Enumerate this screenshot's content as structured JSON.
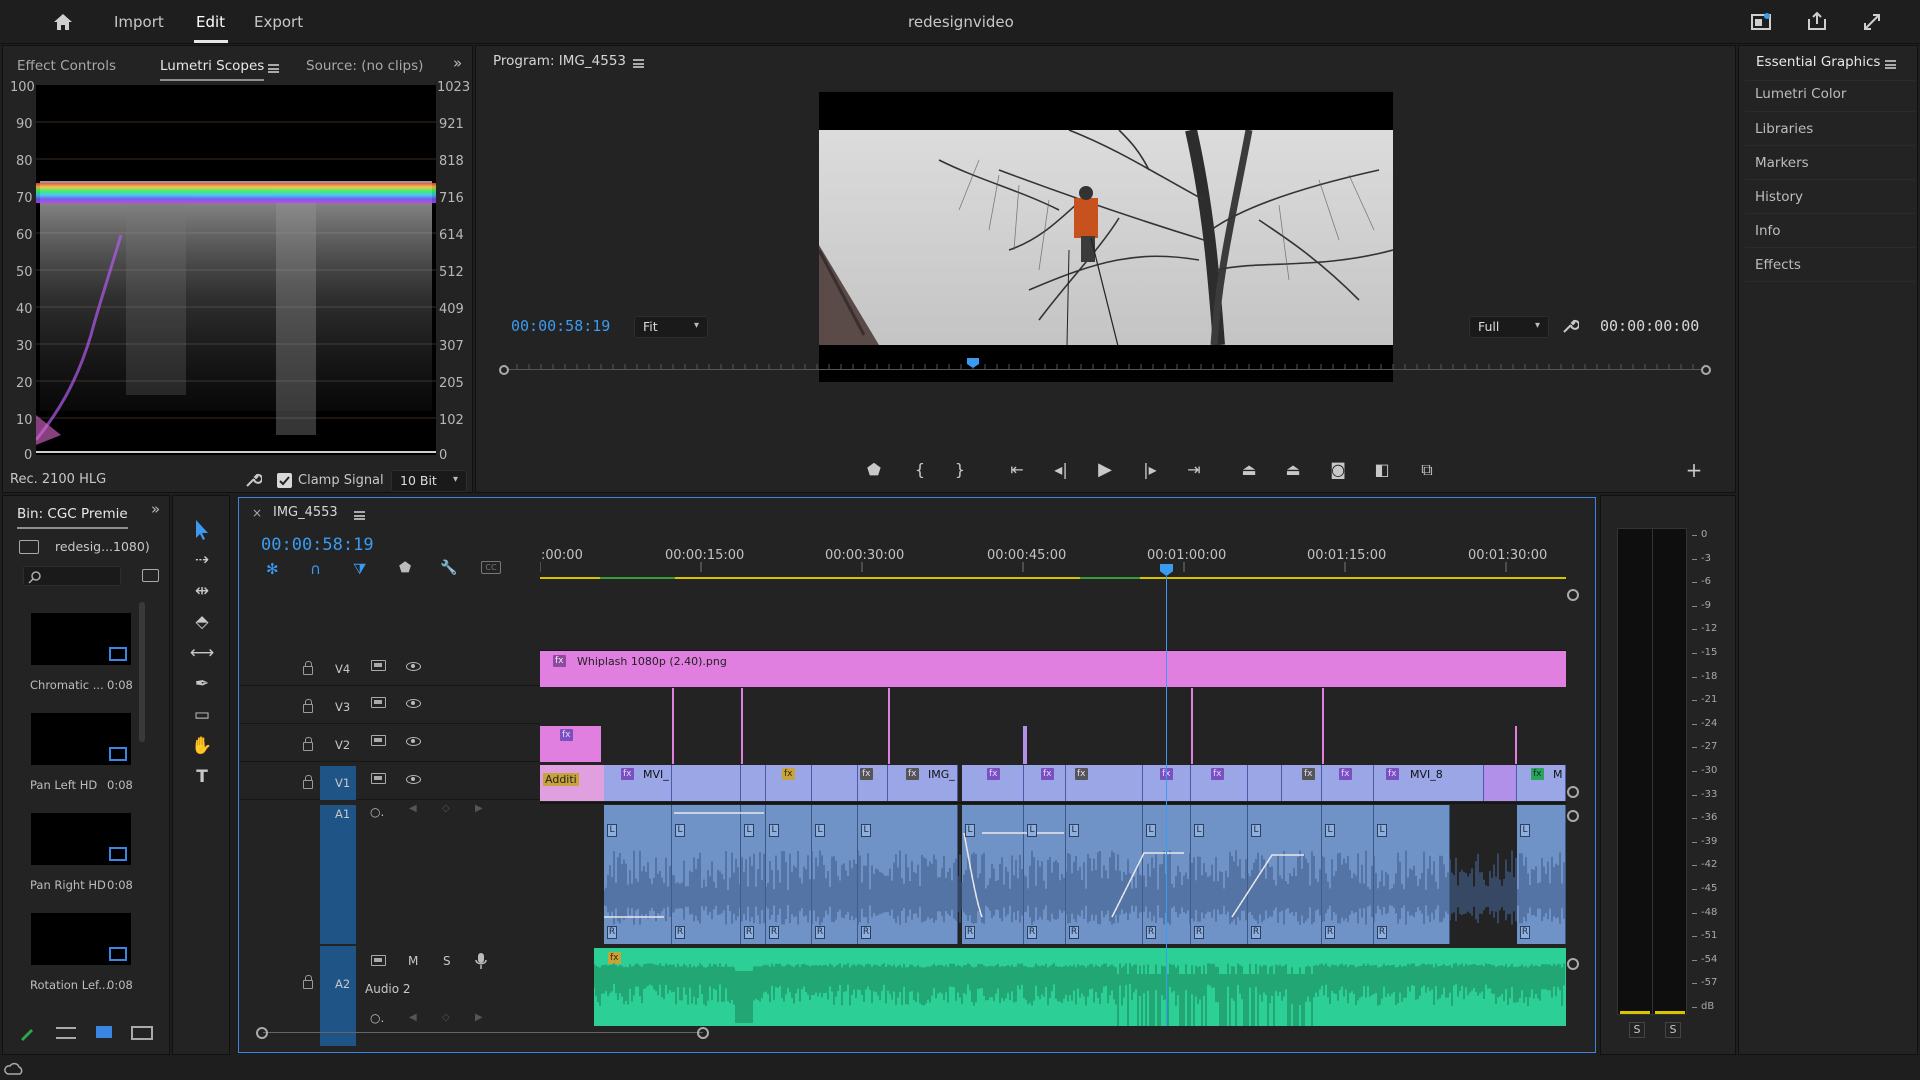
{
  "app": {
    "project_title": "redesignvideo"
  },
  "menu": {
    "import": "Import",
    "edit": "Edit",
    "export": "Export"
  },
  "left_panel": {
    "tabs": [
      "Effect Controls",
      "Lumetri Scopes",
      "Source: (no clips)"
    ],
    "left_scale": [
      "100",
      "90",
      "80",
      "70",
      "60",
      "50",
      "40",
      "30",
      "20",
      "10",
      "0"
    ],
    "right_scale": [
      "1023",
      "921",
      "818",
      "716",
      "614",
      "512",
      "409",
      "307",
      "205",
      "102",
      "0"
    ],
    "color_space": "Rec. 2100 HLG",
    "clamp_signal": "Clamp Signal",
    "clamp_checked": true,
    "bit_depth": "10 Bit"
  },
  "program": {
    "title": "Program: IMG_4553",
    "timecode": "00:00:58:19",
    "fit": "Fit",
    "resolution": "Full",
    "duration": "00:00:00:00",
    "playhead_fraction": 0.39
  },
  "right_panel": {
    "items": [
      "Essential Graphics",
      "Lumetri Color",
      "Libraries",
      "Markers",
      "History",
      "Info",
      "Effects"
    ]
  },
  "bin": {
    "title": "Bin: CGC Premie",
    "path": "redesig...1080)",
    "items": [
      {
        "name": "Chromatic ...",
        "duration": "0:08"
      },
      {
        "name": "Pan Left HD",
        "duration": "0:08"
      },
      {
        "name": "Pan Right HD",
        "duration": "0:08"
      },
      {
        "name": "Rotation Lef...",
        "duration": "0:08"
      }
    ]
  },
  "timeline": {
    "sequence": "IMG_4553",
    "timecode": "00:00:58:19",
    "ruler": [
      ":00:00",
      "00:00:15:00",
      "00:00:30:00",
      "00:00:45:00",
      "00:01:00:00",
      "00:01:15:00",
      "00:01:30:00"
    ],
    "tracks": {
      "v4": "V4",
      "v3": "V3",
      "v2": "V2",
      "v1": "V1",
      "a1": "A1",
      "a2": "A2",
      "a2_name": "Audio 2"
    },
    "clip_v4": "Whiplash 1080p (2.40).png",
    "clip_v2": "Additi",
    "v1_labels": [
      "MVI_",
      "IMG_",
      "MVI_8",
      "M"
    ],
    "fx": "fx",
    "audio_lr": [
      "L",
      "R"
    ],
    "mute": "M",
    "solo": "S"
  },
  "meter": {
    "scale": [
      "0",
      "-3",
      "-6",
      "-9",
      "-12",
      "-15",
      "-18",
      "-21",
      "-24",
      "-27",
      "-30",
      "-33",
      "-36",
      "-39",
      "-42",
      "-45",
      "-48",
      "-51",
      "-54",
      "-57",
      "dB"
    ],
    "solo_left": "S",
    "solo_right": "S"
  },
  "colors": {
    "accent": "#3a9bf0",
    "v4_clip": "#e07fe0",
    "v1_clip": "#9aa6e6",
    "audio1": "#6f93c7",
    "audio2": "#2ccf95"
  }
}
